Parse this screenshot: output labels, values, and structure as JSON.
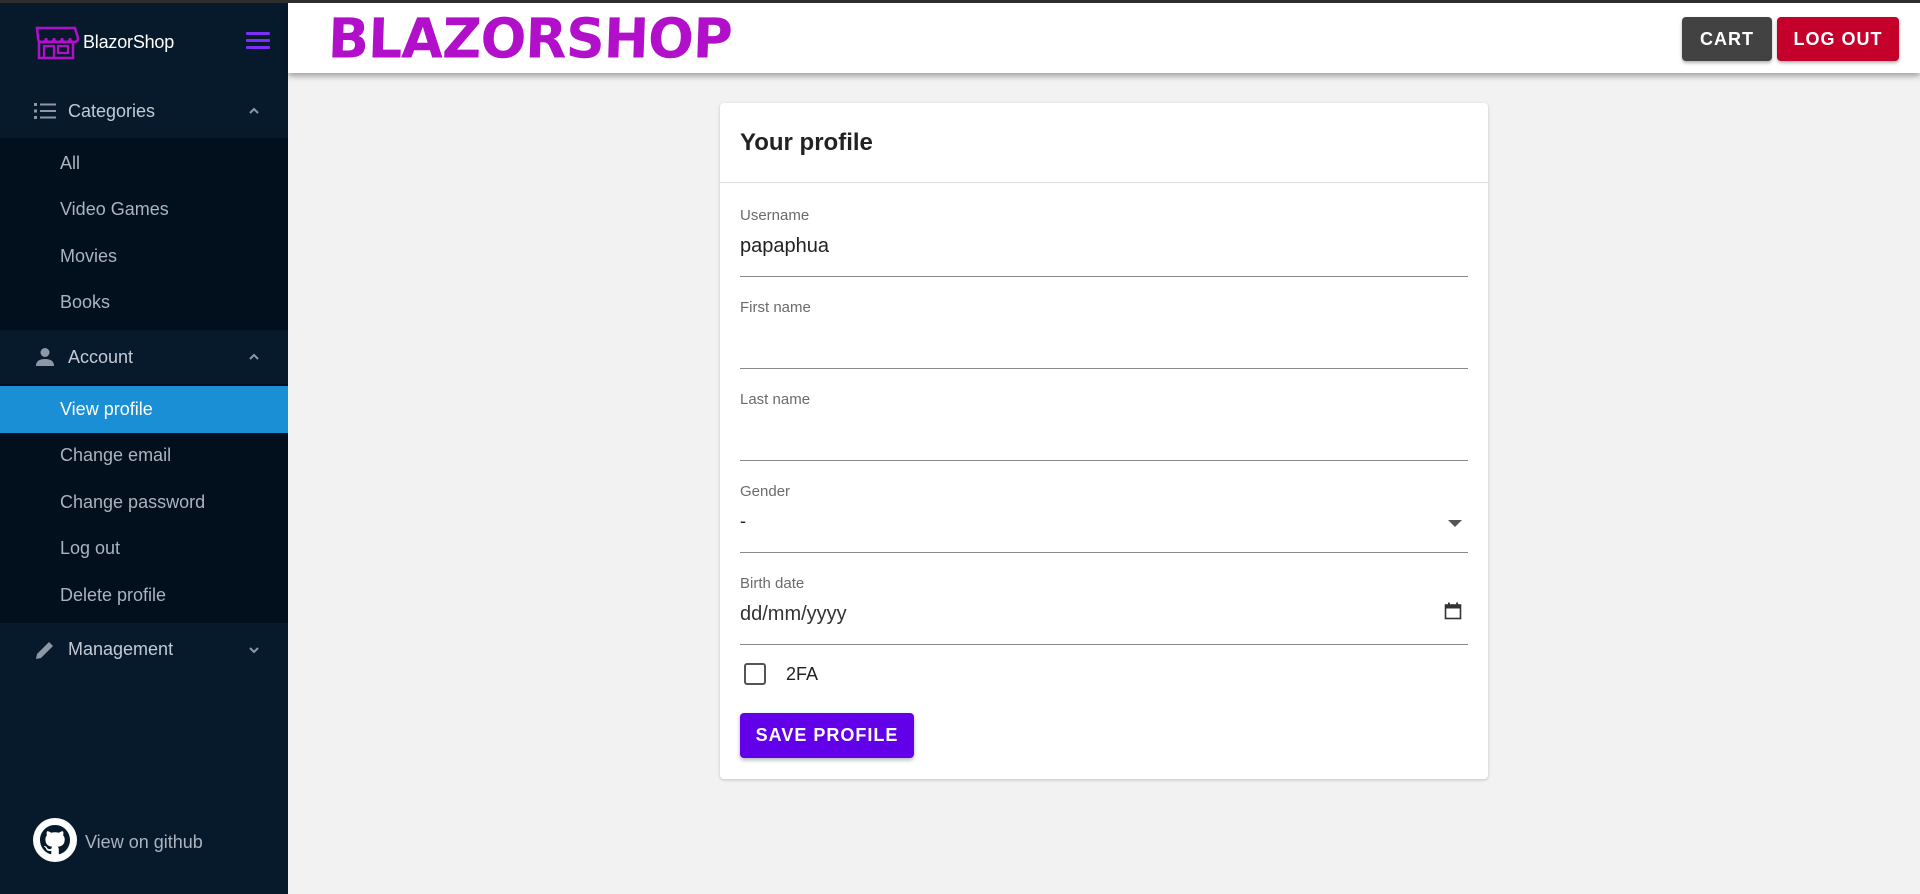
{
  "sidebar": {
    "brand_name": "BlazorShop",
    "groups": [
      {
        "label": "Categories",
        "icon": "list-icon",
        "items": [
          {
            "label": "All"
          },
          {
            "label": "Video Games"
          },
          {
            "label": "Movies"
          },
          {
            "label": "Books"
          }
        ]
      },
      {
        "label": "Account",
        "icon": "person-icon",
        "items": [
          {
            "label": "View profile",
            "active": true
          },
          {
            "label": "Change email"
          },
          {
            "label": "Change password"
          },
          {
            "label": "Log out"
          },
          {
            "label": "Delete profile"
          }
        ]
      },
      {
        "label": "Management",
        "icon": "pencil-icon",
        "items": []
      }
    ],
    "github_label": "View on github"
  },
  "header": {
    "logo_text": "BLAZORSHOP",
    "cart_label": "CART",
    "logout_label": "LOG OUT"
  },
  "profile": {
    "title": "Your profile",
    "username": {
      "label": "Username",
      "value": "papaphua"
    },
    "first_name": {
      "label": "First name",
      "value": ""
    },
    "last_name": {
      "label": "Last name",
      "value": ""
    },
    "gender": {
      "label": "Gender",
      "value": "-"
    },
    "birth_date": {
      "label": "Birth date",
      "placeholder": "dd/mm/yyyy"
    },
    "two_fa": {
      "label": "2FA",
      "checked": false
    },
    "save_label": "SAVE PROFILE"
  },
  "colors": {
    "sidebar_bg": "#071a2c",
    "active_item": "#1a8fd6",
    "logo": "#b10fc9",
    "save_button": "#6200ea",
    "logout_button": "#c4002b",
    "cart_button": "#424242"
  }
}
